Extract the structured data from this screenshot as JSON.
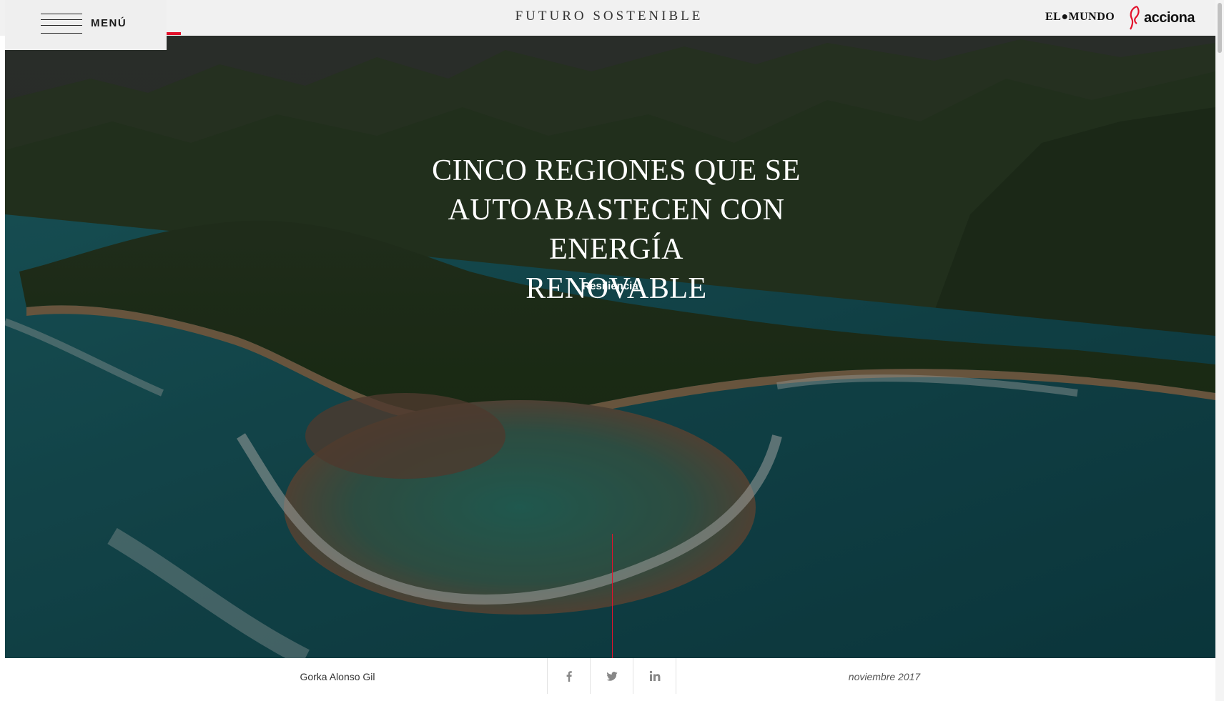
{
  "header": {
    "menu_label": "MENÚ",
    "site_title": "FUTURO SOSTENIBLE",
    "logo_elmundo": "EL●MUNDO",
    "logo_acciona": "acciona"
  },
  "hero": {
    "title_lines": [
      "CINCO REGIONES QUE SE",
      "AUTOABASTECEN CON ENERGÍA",
      "RENOVABLE"
    ],
    "category": "Resiliencia",
    "image_description_icon": "aerial-island-photo"
  },
  "article_meta": {
    "author": "Gorka Alonso Gil",
    "date": "noviembre 2017",
    "share_icons": [
      "facebook-icon",
      "twitter-icon",
      "linkedin-icon"
    ]
  },
  "colors": {
    "accent": "#e3112b",
    "header_bg": "#f1f1f1"
  }
}
